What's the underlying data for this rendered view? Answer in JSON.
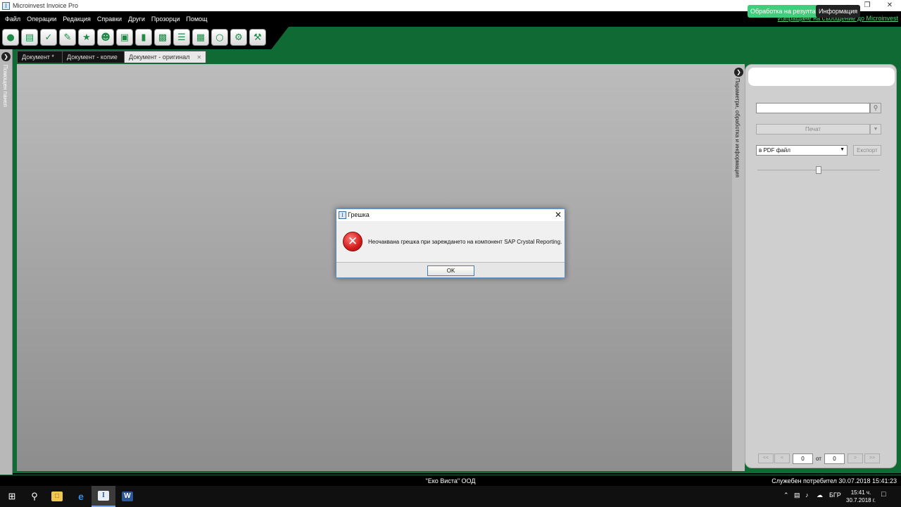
{
  "window": {
    "title": "Microinvest Invoice Pro",
    "icon": "app-logo-icon",
    "controls": [
      "minimize-icon",
      "maximize-icon",
      "close-icon"
    ]
  },
  "menu": {
    "items": [
      "Файл",
      "Операции",
      "Редакция",
      "Справки",
      "Други",
      "Прозорци",
      "Помощ"
    ],
    "report_link": "Изпращане на съобщение до Microinvest"
  },
  "toolbar": {
    "icons": [
      "info-icon",
      "document-icon",
      "check-icon",
      "edit-icon",
      "favorite-icon",
      "users-icon",
      "box-icon",
      "book-icon",
      "chart-icon",
      "list-icon",
      "package-icon",
      "message-icon",
      "gears-icon",
      "settings-icon"
    ]
  },
  "side_panel": {
    "left_label": "Помощен панел",
    "right_label": "Параметри, обработка и информация"
  },
  "tabs": [
    {
      "label": "Документ *"
    },
    {
      "label": "Документ - копие"
    },
    {
      "label": "Документ - оригинал",
      "active": true
    }
  ],
  "right_panel": {
    "tab_process": "Обработка на резултата",
    "tab_info": "Информация",
    "search_value": "",
    "print_label": "Печат",
    "format_selected": "в PDF файл",
    "export_label": "Експорт",
    "pager": {
      "first": "<<",
      "prev": "<",
      "current": "0",
      "of": "от",
      "total": "0",
      "next": ">",
      "last": ">>"
    }
  },
  "dialog": {
    "title": "Грешка",
    "message": "Неочаквана грешка при зареждането на компонент SAP Crystal Reporting.",
    "ok_label": "OK",
    "icon": "error-icon",
    "error_color": "#d21c1c"
  },
  "status": {
    "company": "\"Еко Виста\" ООД",
    "user_time": "Служебен потребител  30.07.2018 15:41:23"
  },
  "taskbar": {
    "language": "БГР",
    "time": "15:41 ч.",
    "date": "30.7.2018 г."
  },
  "colors": {
    "brand_green": "#0f6a34",
    "accent_green": "#3ecf7c",
    "link_green": "#4fd37f"
  }
}
